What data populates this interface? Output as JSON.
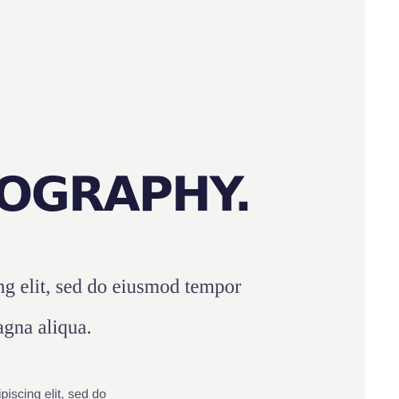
{
  "hero": {
    "heading": "TOGRAPHY.",
    "body_lines": [
      "ng elit, sed do eiusmod tempor",
      "agna aliqua."
    ],
    "small_text": "ipiscing elit, sed do"
  },
  "colors": {
    "panel_background": "#f4f4f3",
    "heading": "#1c1b3c",
    "body_text": "#3f3e57"
  }
}
